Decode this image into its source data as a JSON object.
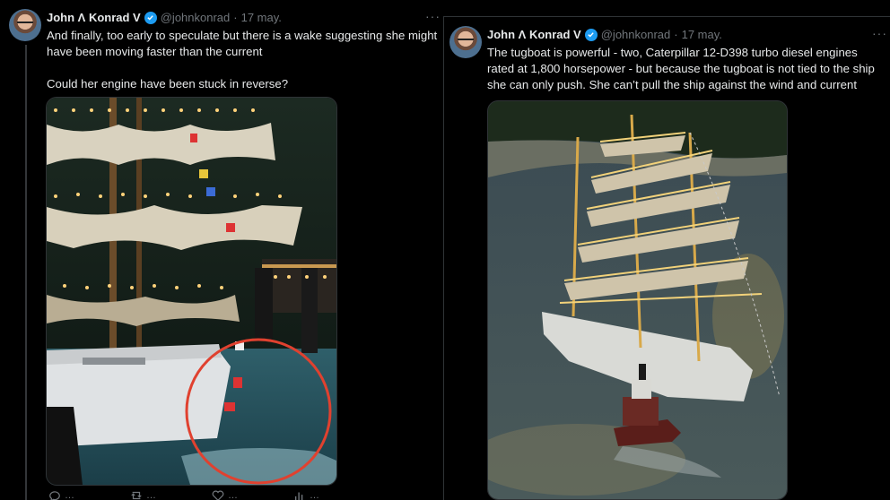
{
  "left_tweet": {
    "author_name": "John Λ Konrad V",
    "handle": "@johnkonrad",
    "dot": "·",
    "date": "17 may.",
    "more": "···",
    "text_line1": "And finally, too early to speculate but there is a wake suggesting she might have been moving faster than the current",
    "text_line2": "Could her engine have been stuck in reverse?",
    "actions": [
      {
        "icon": "reply-icon",
        "count": "…"
      },
      {
        "icon": "retweet-icon",
        "count": "…"
      },
      {
        "icon": "like-icon",
        "count": "…"
      },
      {
        "icon": "views-icon",
        "count": "…"
      }
    ]
  },
  "right_tweet": {
    "author_name": "John Λ Konrad V",
    "handle": "@johnkonrad",
    "dot": "·",
    "date": "17 may.",
    "more": "···",
    "text": "The tugboat is powerful - two, Caterpillar 12-D398 turbo diesel engines rated at 1,800 horsepower - but because the tugboat is not tied to the ship she can only push. She can’t pull the ship against the wind and current"
  },
  "colors": {
    "background": "#000000",
    "text": "#e7e9ea",
    "secondary": "#71767b",
    "verified": "#1d9bf0",
    "highlight_circle": "#e0412f"
  }
}
